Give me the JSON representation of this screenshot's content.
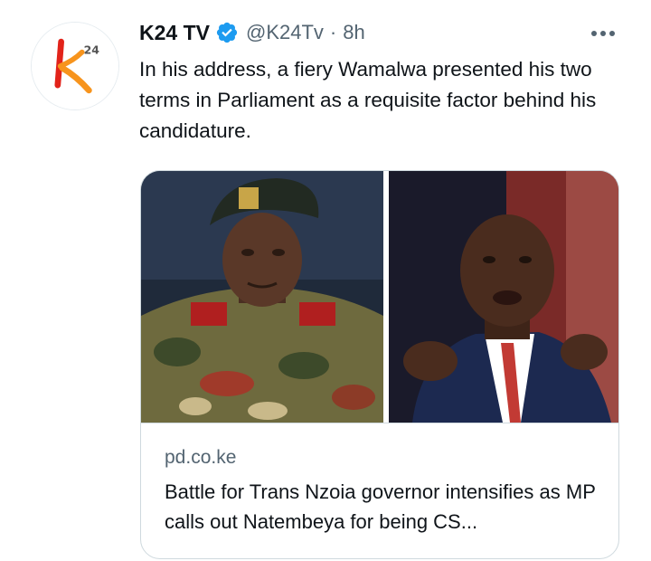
{
  "tweet": {
    "author": {
      "display_name": "K24 TV",
      "handle": "@K24Tv",
      "verified_icon": "verified-badge-icon",
      "avatar_logo_text": "24"
    },
    "separator": "·",
    "time": "8h",
    "more_icon": "more-options-icon",
    "text": "In his address, a fiery Wamalwa presented his two terms in Parliament as a requisite factor behind his candidature.",
    "card": {
      "domain": "pd.co.ke",
      "title": "Battle for Trans Nzoia governor intensifies as MP calls out Natembeya for being CS..."
    }
  },
  "colors": {
    "verified_blue": "#1d9bf0",
    "logo_orange": "#f7941d",
    "logo_red": "#e2231a",
    "secondary_text": "#536471",
    "border": "#cfd9de"
  }
}
